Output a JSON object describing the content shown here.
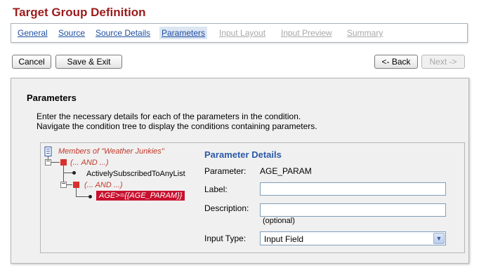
{
  "page": {
    "title": "Target Group Definition"
  },
  "tabs": [
    {
      "label": "General",
      "state": "link"
    },
    {
      "label": "Source",
      "state": "link"
    },
    {
      "label": "Source Details",
      "state": "link"
    },
    {
      "label": "Parameters",
      "state": "active"
    },
    {
      "label": "Input Layout",
      "state": "disabled"
    },
    {
      "label": "Input Preview",
      "state": "disabled"
    },
    {
      "label": "Summary",
      "state": "disabled"
    }
  ],
  "toolbar": {
    "cancel_label": "Cancel",
    "save_exit_label": "Save & Exit",
    "back_label": "<- Back",
    "next_label": "Next ->"
  },
  "panel": {
    "title": "Parameters",
    "description_line1": "Enter the necessary details for each of the parameters in the condition.",
    "description_line2": "Navigate the condition tree to display the conditions containing parameters."
  },
  "tree": {
    "root_label": "Members of \"Weather Junkies\"",
    "and1_label": "(... AND ...)",
    "leaf1_label": "ActivelySubscribedToAnyList",
    "and2_label": "(... AND ...)",
    "selected_label": "AGE>={{AGE_PARAM}}"
  },
  "details": {
    "title": "Parameter Details",
    "parameter_label": "Parameter:",
    "parameter_value": "AGE_PARAM",
    "label_label": "Label:",
    "label_value": "",
    "description_label": "Description:",
    "description_value": "",
    "description_hint": "(optional)",
    "input_type_label": "Input Type:",
    "input_type_value": "Input Field"
  },
  "colors": {
    "title": "#9b1c1c",
    "link": "#1f4fa0",
    "accent": "#2c5aa8",
    "selection": "#c8102e"
  }
}
